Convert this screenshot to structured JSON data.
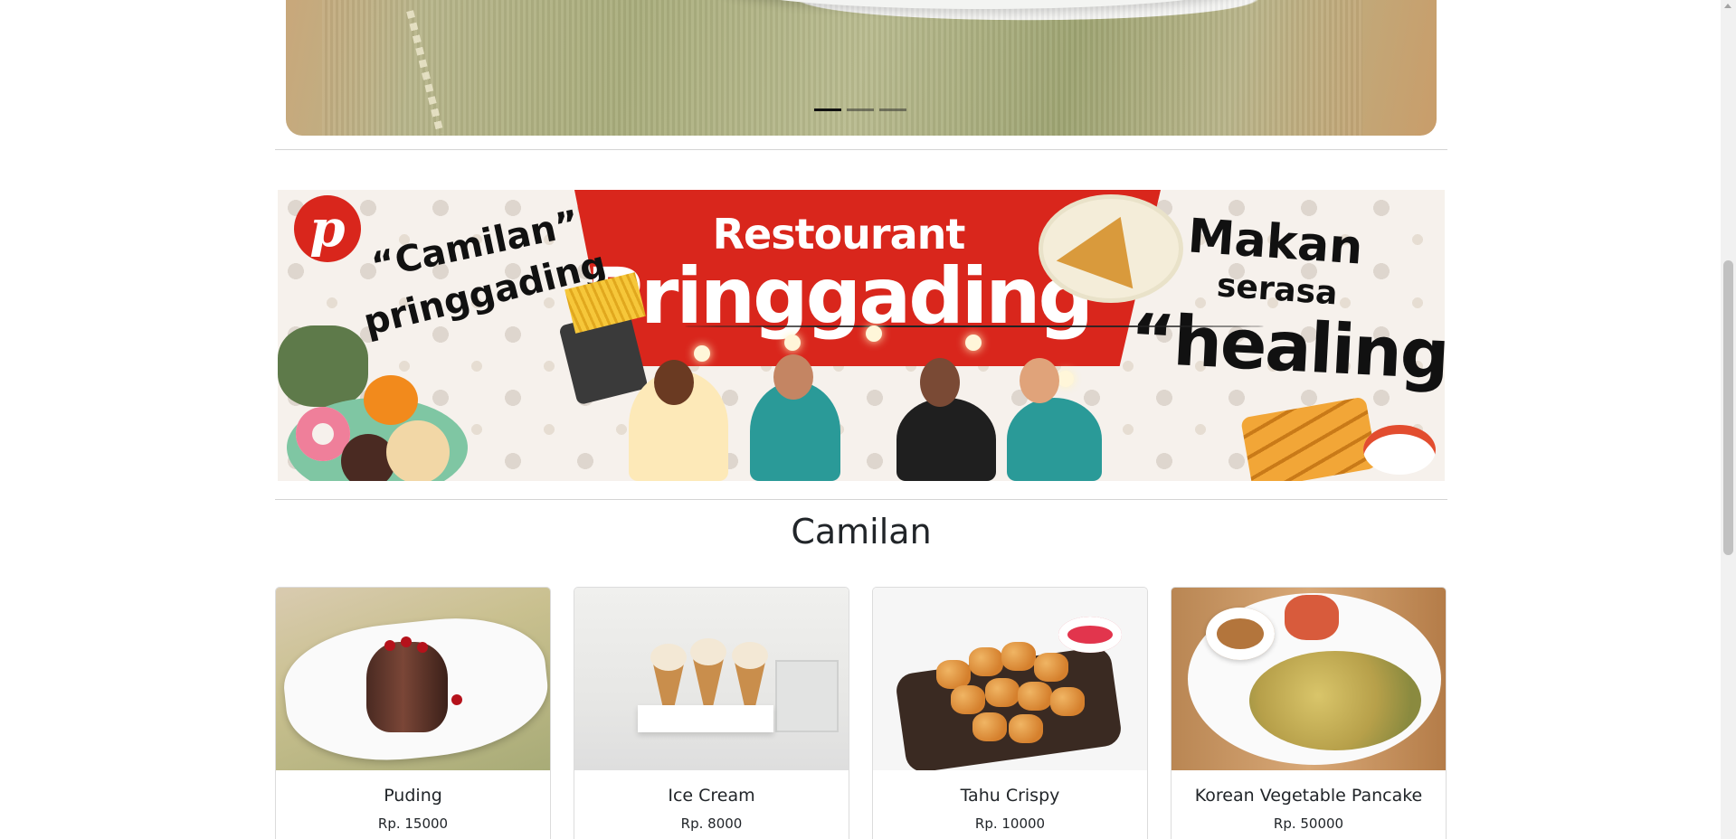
{
  "carousel": {
    "indicators": [
      "slide-1",
      "slide-2",
      "slide-3"
    ],
    "active_index": 0
  },
  "banner": {
    "logo_letter": "p",
    "title_small": "Restourant",
    "title_big": "Pringgading",
    "left_line1": "“Camilan”",
    "left_line2": "pringgading",
    "right_line1": "Makan",
    "right_line2": "serasa",
    "right_line3": "“healing”"
  },
  "section": {
    "title": "Camilan"
  },
  "products": [
    {
      "name": "Puding",
      "price": "Rp. 15000"
    },
    {
      "name": "Ice Cream",
      "price": "Rp. 8000"
    },
    {
      "name": "Tahu Crispy",
      "price": "Rp. 10000"
    },
    {
      "name": "Korean Vegetable Pancake",
      "price": "Rp. 50000"
    }
  ],
  "colors": {
    "accent_red": "#d9261c",
    "text": "#212529",
    "divider": "#d4d4d4"
  }
}
